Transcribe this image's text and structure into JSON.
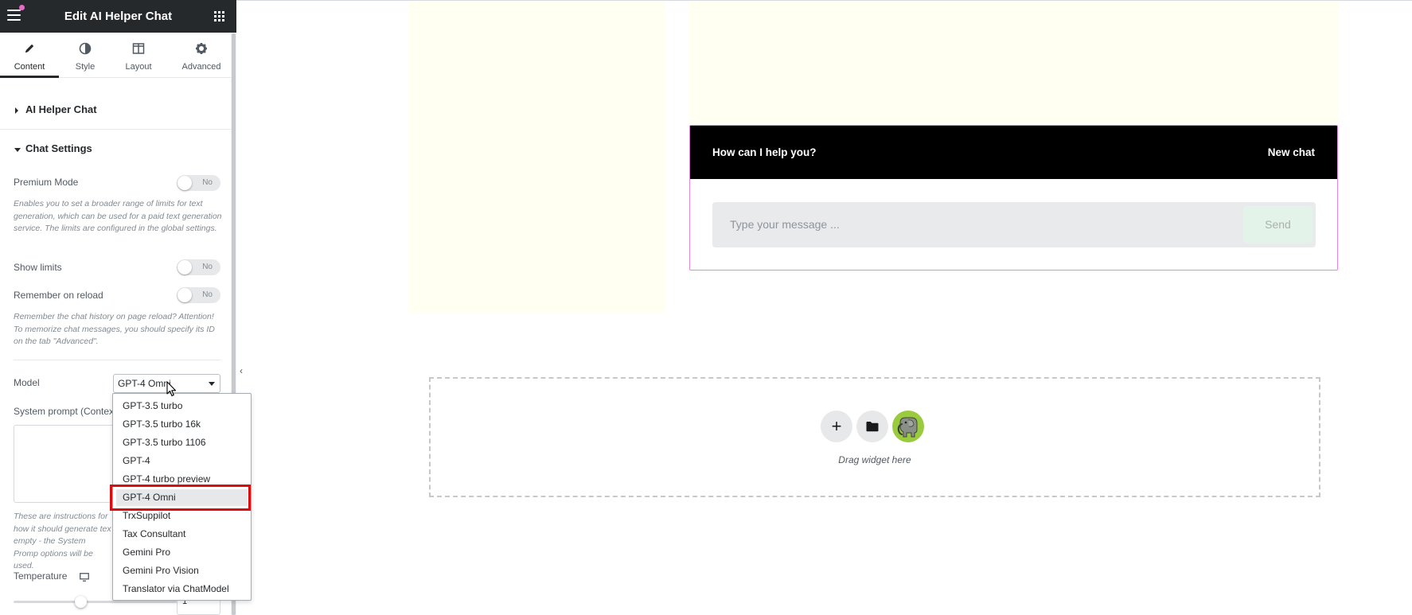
{
  "panel": {
    "title": "Edit AI Helper Chat",
    "tabs": [
      {
        "label": "Content",
        "icon": "pencil-icon"
      },
      {
        "label": "Style",
        "icon": "half-circle-icon"
      },
      {
        "label": "Layout",
        "icon": "layout-icon"
      },
      {
        "label": "Advanced",
        "icon": "gear-icon"
      }
    ],
    "sections": {
      "ai_helper_chat": "AI Helper Chat",
      "chat_settings": "Chat Settings"
    },
    "controls": {
      "premium_mode": {
        "label": "Premium Mode",
        "value": "No",
        "description": "Enables you to set a broader range of limits for text generation, which can be used for a paid text generation service. The limits are configured in the global settings."
      },
      "show_limits": {
        "label": "Show limits",
        "value": "No"
      },
      "remember_on_reload": {
        "label": "Remember on reload",
        "value": "No",
        "description": "Remember the chat history on page reload? Attention! To memorize chat messages, you should specify its ID on the tab \"Advanced\"."
      },
      "model": {
        "label": "Model",
        "value": "GPT-4 Omni"
      },
      "system_prompt": {
        "label": "System prompt (Contex",
        "description": "These are instructions for how it should generate tex empty - the System Promp options will be used."
      },
      "temperature": {
        "label": "Temperature",
        "value": "1",
        "slider_fraction": 0.41
      }
    },
    "model_options": [
      "GPT-3.5 turbo",
      "GPT-3.5 turbo 16k",
      "GPT-3.5 turbo 1106",
      "GPT-4",
      "GPT-4 turbo preview",
      "GPT-4 Omni",
      "TrxSuppilot",
      "Tax Consultant",
      "Gemini Pro",
      "Gemini Pro Vision",
      "Translator via ChatModel"
    ],
    "selected_model": "GPT-4 Omni"
  },
  "chat": {
    "title": "How can I help you?",
    "new_chat": "New chat",
    "placeholder": "Type your message ...",
    "send": "Send"
  },
  "dropzone": {
    "text": "Drag widget here",
    "add_symbol": "+"
  },
  "colors": {
    "header_bg": "#26292c",
    "chat_header_bg": "#000000",
    "widget_outline": "#ea83e3",
    "highlight": "#d90f0f",
    "column_bg": "#fffff2"
  }
}
